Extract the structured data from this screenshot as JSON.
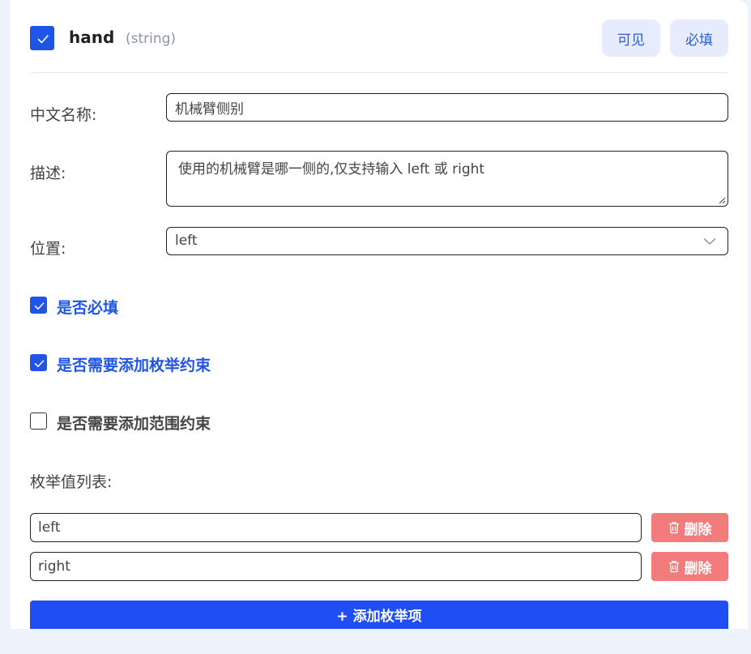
{
  "header": {
    "field_name": "hand",
    "field_type": "(string)",
    "visible_label": "可见",
    "required_label": "必填"
  },
  "form": {
    "chinese_name_label": "中文名称:",
    "chinese_name_value": "机械臂侧别",
    "description_label": "描述:",
    "description_value": "使用的机械臂是哪一侧的,仅支持输入 left 或 right",
    "position_label": "位置:",
    "position_value": "left"
  },
  "options": {
    "required": {
      "label": "是否必填",
      "checked": true
    },
    "enum_constraint": {
      "label": "是否需要添加枚举约束",
      "checked": true
    },
    "range_constraint": {
      "label": "是否需要添加范围约束",
      "checked": false
    }
  },
  "enum": {
    "list_label": "枚举值列表:",
    "items": [
      "left",
      "right"
    ],
    "delete_label": "删除",
    "add_label": "+ 添加枚举项"
  },
  "colors": {
    "accent": "#1f55e6",
    "delete": "#f27b7b",
    "pill_bg": "#e6ecfb"
  }
}
